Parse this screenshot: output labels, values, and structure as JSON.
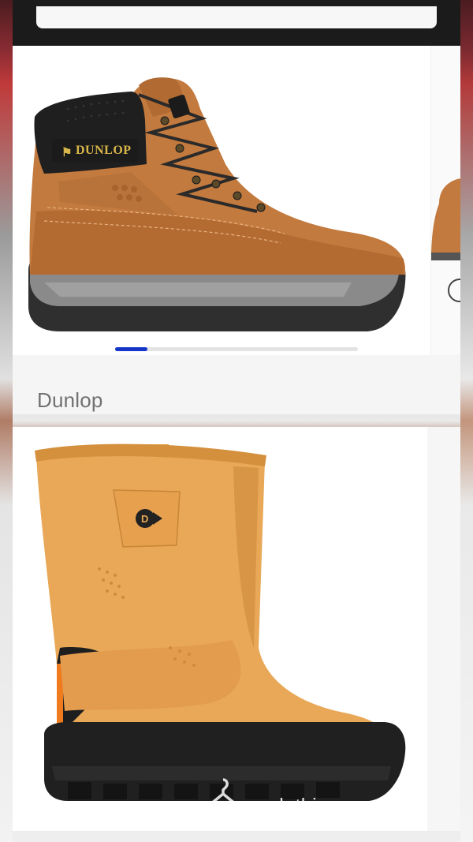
{
  "brand": {
    "name": "Dunlop"
  },
  "boot1": {
    "collar_logo_text": "DUNLOP"
  },
  "carousel": {
    "slide_count": 8,
    "active_index": 0
  },
  "watermark": {
    "text": "malethingsu"
  },
  "icons": [
    "hanger-icon"
  ],
  "colors": {
    "accent": "#1536c9",
    "boot_tan": "#c37a3e",
    "rigger_tan": "#e8a857"
  }
}
